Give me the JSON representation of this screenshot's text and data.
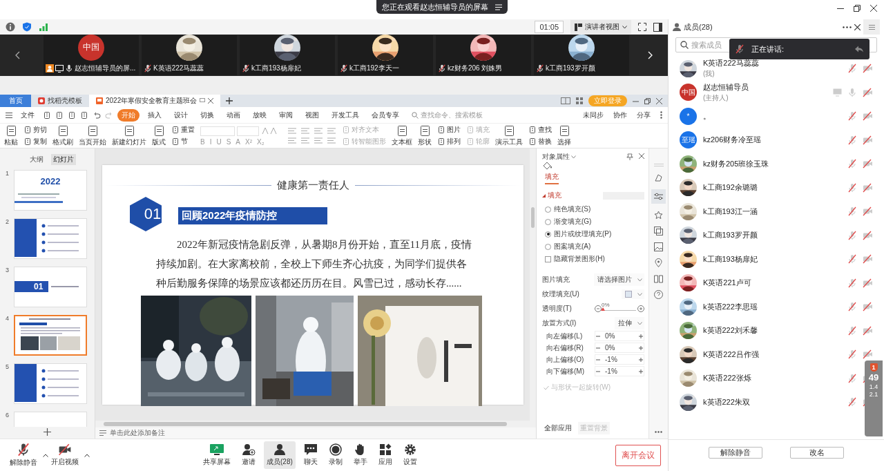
{
  "banner": {
    "text": "您正在观看赵志恒辅导员的屏幕"
  },
  "toolbar": {
    "time": "01:05",
    "view": "演讲者视图"
  },
  "videos": [
    {
      "name": "赵志恒辅导员的屏...",
      "avatar": {
        "kind": "text",
        "label": "中国",
        "color": "#c8332c"
      },
      "presenter": true,
      "mic_muted": false
    },
    {
      "name": "K英语222马蕊蕊",
      "presenter": false,
      "mic_muted": true
    },
    {
      "name": "k工商193杨扉妃",
      "presenter": false,
      "mic_muted": true
    },
    {
      "name": "k工商192李天一",
      "presenter": false,
      "mic_muted": true
    },
    {
      "name": "kz财务206 刘姝男",
      "presenter": false,
      "mic_muted": true
    },
    {
      "name": "k工商193罗开颜",
      "presenter": false,
      "mic_muted": true
    }
  ],
  "wps": {
    "tabs": [
      {
        "label": "首页",
        "kind": "home",
        "selected": false
      },
      {
        "label": "找稻壳模板",
        "kind": "template",
        "selected": false
      },
      {
        "label": "2022年寒假安全教育主题班会",
        "kind": "slides",
        "selected": true
      }
    ],
    "login": "立即登录",
    "file_menu": "文件",
    "menu": [
      {
        "label": "开始",
        "selected": true
      },
      {
        "label": "插入",
        "selected": false
      },
      {
        "label": "设计",
        "selected": false
      },
      {
        "label": "切换",
        "selected": false
      },
      {
        "label": "动画",
        "selected": false
      },
      {
        "label": "放映",
        "selected": false
      },
      {
        "label": "审阅",
        "selected": false
      },
      {
        "label": "视图",
        "selected": false
      },
      {
        "label": "开发工具",
        "selected": false
      },
      {
        "label": "会员专享",
        "selected": false
      }
    ],
    "search": "查找命令、搜索模板",
    "actions": [
      "未同步",
      "协作",
      "分享"
    ],
    "ribbon": [
      {
        "kind": "big",
        "label": "粘贴",
        "disabled": false
      },
      {
        "kind": "stack",
        "items": [
          {
            "label": "剪切",
            "disabled": false
          },
          {
            "label": "复制",
            "disabled": false
          }
        ]
      },
      {
        "kind": "big",
        "label": "格式刷",
        "disabled": false
      },
      {
        "kind": "big",
        "label": "当页开始",
        "disabled": false
      },
      {
        "kind": "big",
        "label": "新建幻灯片",
        "disabled": false
      },
      {
        "kind": "big",
        "label": "版式",
        "disabled": false
      },
      {
        "kind": "stack",
        "items": [
          {
            "label": "重置",
            "disabled": false
          },
          {
            "label": "节",
            "disabled": false
          }
        ]
      },
      {
        "kind": "font",
        "glyphs": [
          "B",
          "I",
          "U",
          "S",
          "A",
          "X²",
          "X₂"
        ]
      },
      {
        "kind": "para"
      },
      {
        "kind": "stack",
        "items": [
          {
            "label": "对齐文本",
            "disabled": true
          },
          {
            "label": "转智能图形",
            "disabled": true
          }
        ]
      },
      {
        "kind": "big",
        "label": "文本框",
        "disabled": false
      },
      {
        "kind": "big",
        "label": "形状",
        "disabled": false
      },
      {
        "kind": "stack",
        "items": [
          {
            "label": "图片",
            "disabled": false
          },
          {
            "label": "排列",
            "disabled": false
          }
        ]
      },
      {
        "kind": "stack",
        "items": [
          {
            "label": "填充",
            "disabled": true
          },
          {
            "label": "轮廓",
            "disabled": true
          }
        ]
      },
      {
        "kind": "big",
        "label": "演示工具",
        "disabled": false
      },
      {
        "kind": "stack",
        "items": [
          {
            "label": "查找",
            "disabled": false
          },
          {
            "label": "替换",
            "disabled": false
          }
        ]
      },
      {
        "kind": "big",
        "label": "选择",
        "disabled": false
      }
    ]
  },
  "thumb_tabs": [
    {
      "label": "大纲",
      "selected": false
    },
    {
      "label": "幻灯片",
      "selected": true
    }
  ],
  "thumbnails": [
    {
      "number": "1",
      "kind": "cover",
      "label": "2022",
      "selected": false
    },
    {
      "number": "2",
      "kind": "list",
      "selected": false
    },
    {
      "number": "3",
      "kind": "section",
      "label": "01",
      "selected": false
    },
    {
      "number": "4",
      "kind": "content",
      "selected": true
    },
    {
      "number": "5",
      "kind": "list",
      "selected": false
    },
    {
      "number": "6",
      "kind": "blank",
      "selected": false
    }
  ],
  "slide": {
    "title": "健康第一责任人",
    "number": "01",
    "heading": "回顾2022年疫情防控",
    "paragraph": "2022年新冠疫情急剧反弹，从暑期8月份开始，直至11月底，疫情持续加剧。在大家离校前，全校上下师生齐心抗疫，为同学们提供各种后勤服务保障的场景应该都还历历在目。风雪已过，感动长存......"
  },
  "notes": "单击此处添加备注",
  "properties": {
    "title": "对象属性",
    "tab": "填充",
    "section": "填充",
    "fill_types": [
      {
        "label": "纯色填充(S)",
        "selected": false
      },
      {
        "label": "渐变填充(G)",
        "selected": false
      },
      {
        "label": "图片或纹理填充(P)",
        "selected": true
      },
      {
        "label": "图案填充(A)",
        "selected": false
      }
    ],
    "hide_background": {
      "label": "隐藏背景图形(H)",
      "checked": false
    },
    "rows": [
      {
        "label": "图片填充",
        "kind": "dropdown",
        "value": "请选择图片"
      },
      {
        "label": "纹理填充(U)",
        "kind": "texture"
      },
      {
        "label": "透明度(T)",
        "kind": "slider",
        "reading": "0%",
        "level": 0
      },
      {
        "label": "放置方式(I)",
        "kind": "dropdown",
        "value": "拉伸"
      }
    ],
    "offsets": [
      {
        "label": "向左偏移(L)",
        "value": "0%"
      },
      {
        "label": "向右偏移(R)",
        "value": "0%"
      },
      {
        "label": "向上偏移(O)",
        "value": "-1%"
      },
      {
        "label": "向下偏移(M)",
        "value": "-1%"
      }
    ],
    "rotate": {
      "label": "与形状一起旋转(W)",
      "checked": true,
      "disabled": true
    },
    "buttons": [
      {
        "label": "全部应用",
        "disabled": false
      },
      {
        "label": "重置背景",
        "disabled": true
      }
    ]
  },
  "meeting_bar": {
    "left": [
      {
        "label": "解除静音",
        "kind": "mic"
      },
      {
        "label": "开启视频",
        "kind": "camera"
      }
    ],
    "center": [
      {
        "label": "共享屏幕",
        "kind": "share",
        "selected": false
      },
      {
        "label": "邀请",
        "kind": "invite",
        "selected": false
      },
      {
        "label": "成员(28)",
        "kind": "members",
        "selected": true
      },
      {
        "label": "聊天",
        "kind": "chat",
        "selected": false
      },
      {
        "label": "录制",
        "kind": "record",
        "selected": false
      },
      {
        "label": "举手",
        "kind": "hand",
        "selected": false
      },
      {
        "label": "应用",
        "kind": "apps",
        "selected": false
      },
      {
        "label": "设置",
        "kind": "settings",
        "selected": false
      }
    ],
    "leave": "离开会议"
  },
  "members_panel": {
    "title": "成员(28)",
    "search_placeholder": "搜索成员",
    "speaking": "正在讲话:",
    "members": [
      {
        "name": "K英语222马蕊蕊",
        "note": "(我)",
        "sharing": false,
        "mic_muted": true,
        "camera_off": true
      },
      {
        "name": "赵志恒辅导员",
        "note": "(主持人)",
        "avatar": {
          "kind": "text",
          "label": "中国",
          "color": "#c8332c"
        },
        "sharing": true,
        "mic_muted": false,
        "camera_off": true
      },
      {
        "name": "。",
        "avatar": {
          "kind": "text",
          "label": "*",
          "color": "#1a73e8"
        },
        "sharing": false,
        "mic_muted": true,
        "camera_off": true
      },
      {
        "name": "kz206财务冷至瑶",
        "avatar": {
          "kind": "text",
          "label": "至瑶",
          "color": "#1a73e8"
        },
        "sharing": false,
        "mic_muted": true,
        "camera_off": true
      },
      {
        "name": "kz财务205班徐玉珠",
        "sharing": false,
        "mic_muted": true,
        "camera_off": true
      },
      {
        "name": "k工商192余璐璐",
        "sharing": false,
        "mic_muted": true,
        "camera_off": true
      },
      {
        "name": "k工商193江一涵",
        "sharing": false,
        "mic_muted": true,
        "camera_off": true
      },
      {
        "name": "k工商193罗开颜",
        "sharing": false,
        "mic_muted": true,
        "camera_off": true
      },
      {
        "name": "k工商193杨扉妃",
        "sharing": false,
        "mic_muted": true,
        "camera_off": true
      },
      {
        "name": "K英语221卢可",
        "sharing": false,
        "mic_muted": true,
        "camera_off": true
      },
      {
        "name": "k英语222李思瑶",
        "sharing": false,
        "mic_muted": true,
        "camera_off": true
      },
      {
        "name": "k英语222刘禾馨",
        "sharing": false,
        "mic_muted": true,
        "camera_off": true
      },
      {
        "name": "K英语222吕作强",
        "sharing": false,
        "mic_muted": true,
        "camera_off": true
      },
      {
        "name": "K英语222张烁",
        "sharing": false,
        "mic_muted": true,
        "camera_off": true
      },
      {
        "name": "k英语222朱双",
        "sharing": false,
        "mic_muted": true,
        "camera_off": true
      }
    ],
    "buttons": [
      "解除静音",
      "改名"
    ]
  },
  "network": {
    "alert": "1",
    "score": "49",
    "upload": "1.4",
    "download": "2.1"
  }
}
